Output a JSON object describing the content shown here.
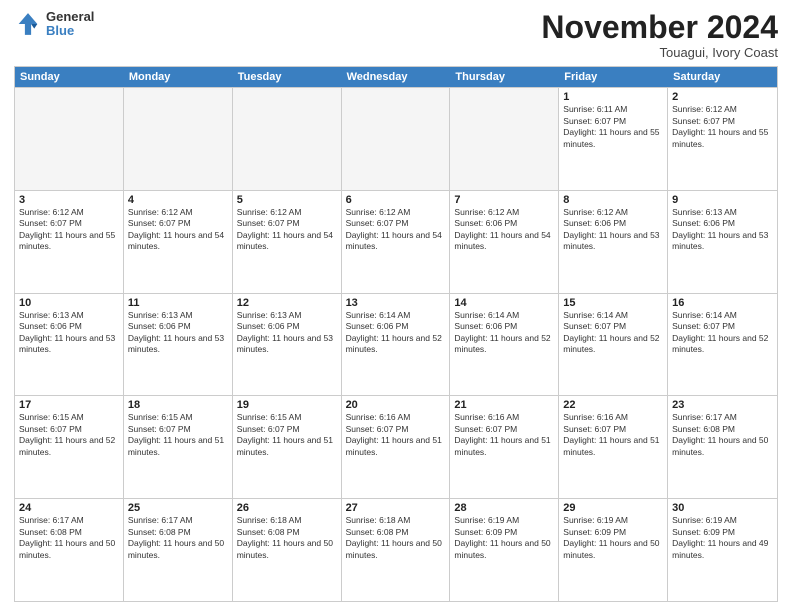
{
  "logo": {
    "line1": "General",
    "line2": "Blue"
  },
  "title": {
    "month": "November 2024",
    "location": "Touagui, Ivory Coast"
  },
  "weekdays": [
    "Sunday",
    "Monday",
    "Tuesday",
    "Wednesday",
    "Thursday",
    "Friday",
    "Saturday"
  ],
  "weeks": [
    [
      {
        "day": "",
        "empty": true
      },
      {
        "day": "",
        "empty": true
      },
      {
        "day": "",
        "empty": true
      },
      {
        "day": "",
        "empty": true
      },
      {
        "day": "",
        "empty": true
      },
      {
        "day": "1",
        "sunrise": "Sunrise: 6:11 AM",
        "sunset": "Sunset: 6:07 PM",
        "daylight": "Daylight: 11 hours and 55 minutes."
      },
      {
        "day": "2",
        "sunrise": "Sunrise: 6:12 AM",
        "sunset": "Sunset: 6:07 PM",
        "daylight": "Daylight: 11 hours and 55 minutes."
      }
    ],
    [
      {
        "day": "3",
        "sunrise": "Sunrise: 6:12 AM",
        "sunset": "Sunset: 6:07 PM",
        "daylight": "Daylight: 11 hours and 55 minutes."
      },
      {
        "day": "4",
        "sunrise": "Sunrise: 6:12 AM",
        "sunset": "Sunset: 6:07 PM",
        "daylight": "Daylight: 11 hours and 54 minutes."
      },
      {
        "day": "5",
        "sunrise": "Sunrise: 6:12 AM",
        "sunset": "Sunset: 6:07 PM",
        "daylight": "Daylight: 11 hours and 54 minutes."
      },
      {
        "day": "6",
        "sunrise": "Sunrise: 6:12 AM",
        "sunset": "Sunset: 6:07 PM",
        "daylight": "Daylight: 11 hours and 54 minutes."
      },
      {
        "day": "7",
        "sunrise": "Sunrise: 6:12 AM",
        "sunset": "Sunset: 6:06 PM",
        "daylight": "Daylight: 11 hours and 54 minutes."
      },
      {
        "day": "8",
        "sunrise": "Sunrise: 6:12 AM",
        "sunset": "Sunset: 6:06 PM",
        "daylight": "Daylight: 11 hours and 53 minutes."
      },
      {
        "day": "9",
        "sunrise": "Sunrise: 6:13 AM",
        "sunset": "Sunset: 6:06 PM",
        "daylight": "Daylight: 11 hours and 53 minutes."
      }
    ],
    [
      {
        "day": "10",
        "sunrise": "Sunrise: 6:13 AM",
        "sunset": "Sunset: 6:06 PM",
        "daylight": "Daylight: 11 hours and 53 minutes."
      },
      {
        "day": "11",
        "sunrise": "Sunrise: 6:13 AM",
        "sunset": "Sunset: 6:06 PM",
        "daylight": "Daylight: 11 hours and 53 minutes."
      },
      {
        "day": "12",
        "sunrise": "Sunrise: 6:13 AM",
        "sunset": "Sunset: 6:06 PM",
        "daylight": "Daylight: 11 hours and 53 minutes."
      },
      {
        "day": "13",
        "sunrise": "Sunrise: 6:14 AM",
        "sunset": "Sunset: 6:06 PM",
        "daylight": "Daylight: 11 hours and 52 minutes."
      },
      {
        "day": "14",
        "sunrise": "Sunrise: 6:14 AM",
        "sunset": "Sunset: 6:06 PM",
        "daylight": "Daylight: 11 hours and 52 minutes."
      },
      {
        "day": "15",
        "sunrise": "Sunrise: 6:14 AM",
        "sunset": "Sunset: 6:07 PM",
        "daylight": "Daylight: 11 hours and 52 minutes."
      },
      {
        "day": "16",
        "sunrise": "Sunrise: 6:14 AM",
        "sunset": "Sunset: 6:07 PM",
        "daylight": "Daylight: 11 hours and 52 minutes."
      }
    ],
    [
      {
        "day": "17",
        "sunrise": "Sunrise: 6:15 AM",
        "sunset": "Sunset: 6:07 PM",
        "daylight": "Daylight: 11 hours and 52 minutes."
      },
      {
        "day": "18",
        "sunrise": "Sunrise: 6:15 AM",
        "sunset": "Sunset: 6:07 PM",
        "daylight": "Daylight: 11 hours and 51 minutes."
      },
      {
        "day": "19",
        "sunrise": "Sunrise: 6:15 AM",
        "sunset": "Sunset: 6:07 PM",
        "daylight": "Daylight: 11 hours and 51 minutes."
      },
      {
        "day": "20",
        "sunrise": "Sunrise: 6:16 AM",
        "sunset": "Sunset: 6:07 PM",
        "daylight": "Daylight: 11 hours and 51 minutes."
      },
      {
        "day": "21",
        "sunrise": "Sunrise: 6:16 AM",
        "sunset": "Sunset: 6:07 PM",
        "daylight": "Daylight: 11 hours and 51 minutes."
      },
      {
        "day": "22",
        "sunrise": "Sunrise: 6:16 AM",
        "sunset": "Sunset: 6:07 PM",
        "daylight": "Daylight: 11 hours and 51 minutes."
      },
      {
        "day": "23",
        "sunrise": "Sunrise: 6:17 AM",
        "sunset": "Sunset: 6:08 PM",
        "daylight": "Daylight: 11 hours and 50 minutes."
      }
    ],
    [
      {
        "day": "24",
        "sunrise": "Sunrise: 6:17 AM",
        "sunset": "Sunset: 6:08 PM",
        "daylight": "Daylight: 11 hours and 50 minutes."
      },
      {
        "day": "25",
        "sunrise": "Sunrise: 6:17 AM",
        "sunset": "Sunset: 6:08 PM",
        "daylight": "Daylight: 11 hours and 50 minutes."
      },
      {
        "day": "26",
        "sunrise": "Sunrise: 6:18 AM",
        "sunset": "Sunset: 6:08 PM",
        "daylight": "Daylight: 11 hours and 50 minutes."
      },
      {
        "day": "27",
        "sunrise": "Sunrise: 6:18 AM",
        "sunset": "Sunset: 6:08 PM",
        "daylight": "Daylight: 11 hours and 50 minutes."
      },
      {
        "day": "28",
        "sunrise": "Sunrise: 6:19 AM",
        "sunset": "Sunset: 6:09 PM",
        "daylight": "Daylight: 11 hours and 50 minutes."
      },
      {
        "day": "29",
        "sunrise": "Sunrise: 6:19 AM",
        "sunset": "Sunset: 6:09 PM",
        "daylight": "Daylight: 11 hours and 50 minutes."
      },
      {
        "day": "30",
        "sunrise": "Sunrise: 6:19 AM",
        "sunset": "Sunset: 6:09 PM",
        "daylight": "Daylight: 11 hours and 49 minutes."
      }
    ]
  ]
}
